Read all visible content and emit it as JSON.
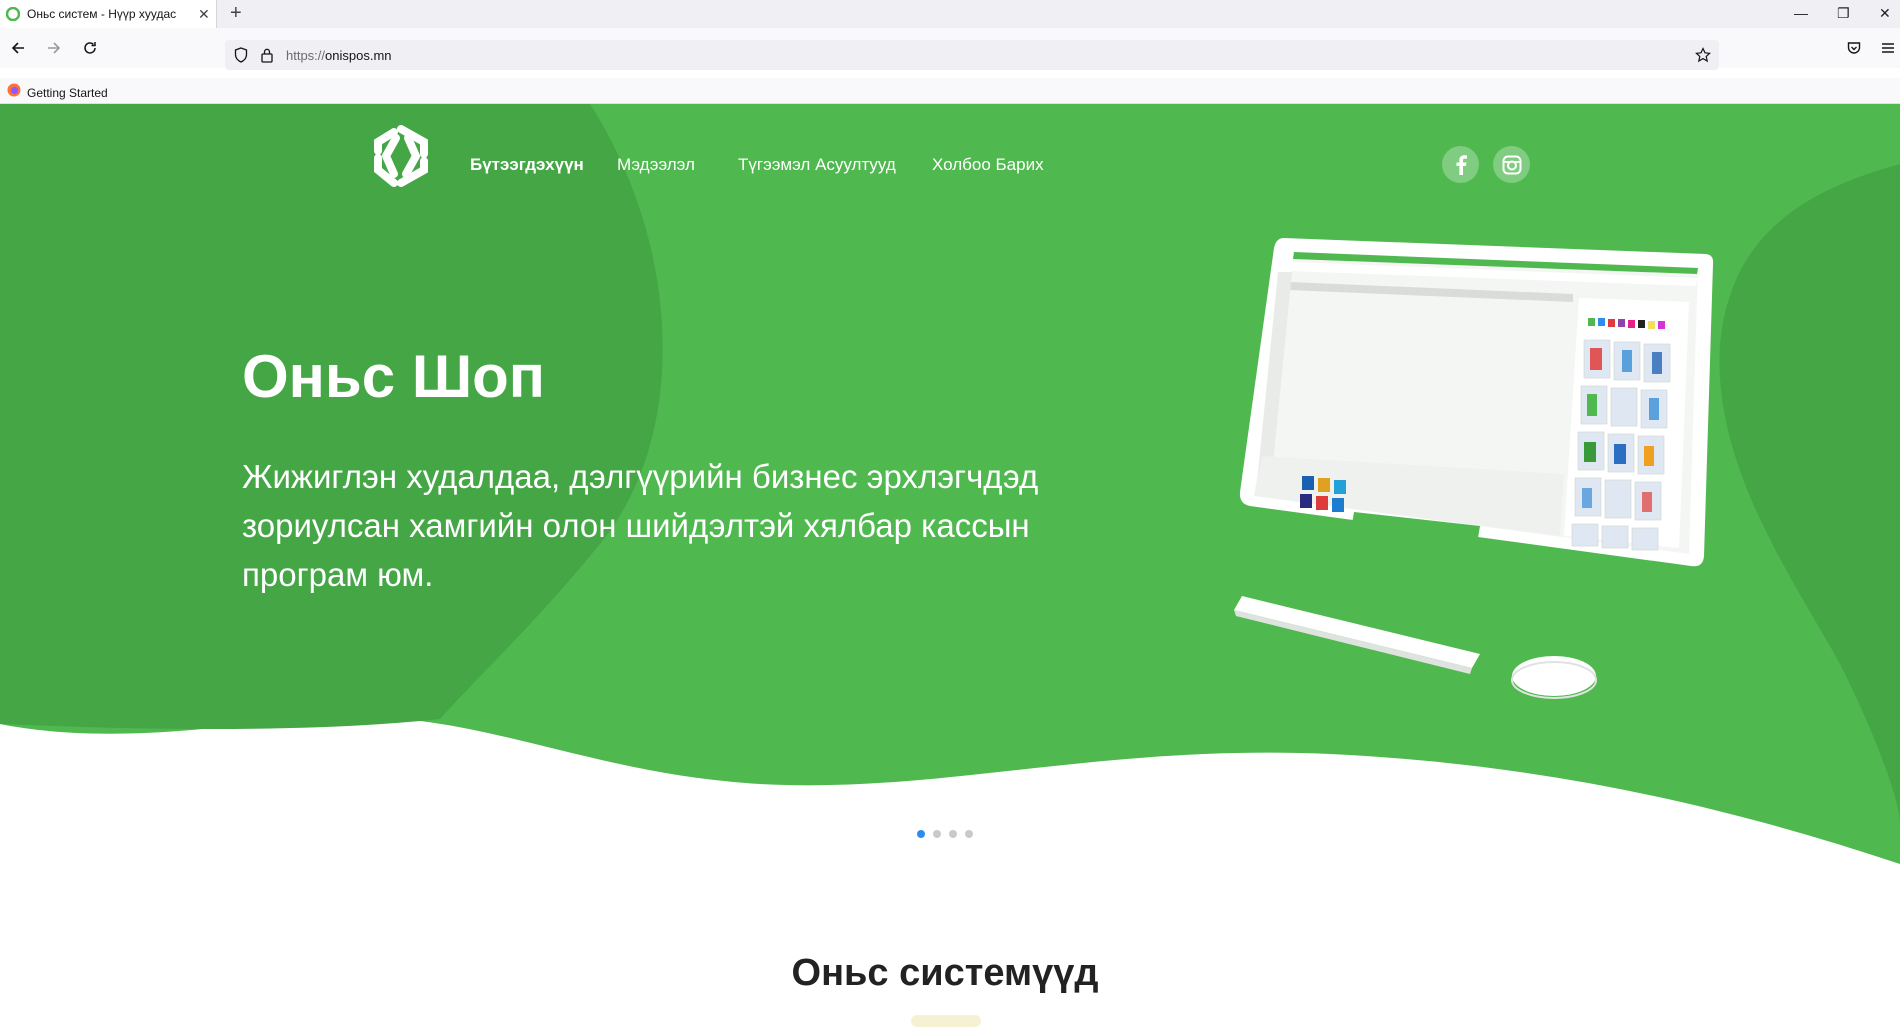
{
  "browser": {
    "tab_title": "Оньс систем  - Нүүр хуудас",
    "url_scheme": "https://",
    "url_host": "onispos.mn",
    "bookmark_label": "Getting Started"
  },
  "header": {
    "nav": [
      "Бүтээгдэхүүн",
      "Мэдээлэл",
      "Түгээмэл Асуултууд",
      "Холбоо Барих"
    ],
    "active_index": 0,
    "social_icons": [
      "facebook-icon",
      "instagram-icon"
    ]
  },
  "hero": {
    "title": "Оньс Шоп",
    "subtitle": "Жижиглэн худалдаа, дэлгүүрийн бизнес эрхлэгчдэд зориулсан хамгийн олон шийдэлтэй хялбар кассын програм юм.",
    "carousel_slides": 4,
    "carousel_active": 0
  },
  "section": {
    "title": "Оньс системүүд"
  },
  "colors": {
    "hero_green": "#4fb950",
    "hero_green_dark": "#45a646",
    "carousel_active": "#2d8cf0",
    "text_dark": "#222222"
  }
}
